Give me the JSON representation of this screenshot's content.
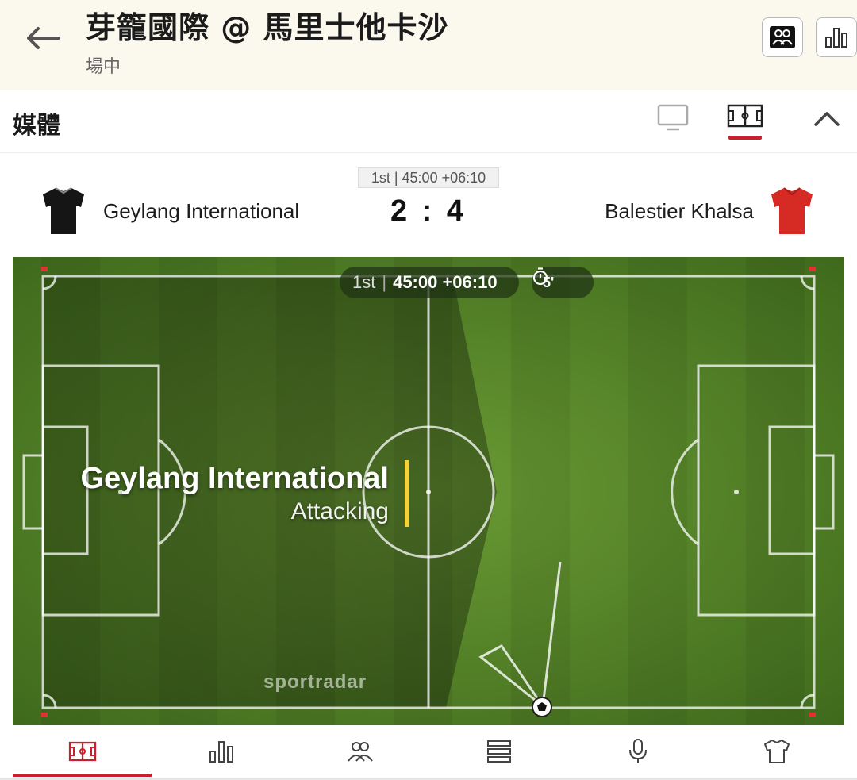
{
  "header": {
    "title": "芽籠國際 @ 馬里士他卡沙",
    "status": "場中",
    "icons": {
      "back": "arrow-left-icon",
      "lineups": "lineups-icon",
      "stats": "stats-bar-icon"
    }
  },
  "media": {
    "label": "媒體",
    "icons": {
      "tv": "tv-icon",
      "pitch": "pitch-tracker-icon",
      "collapse": "chevron-up-icon"
    },
    "accent": "#c8202d"
  },
  "match": {
    "period": "1st | 45:00 +06:10",
    "home": {
      "name": "Geylang International",
      "shirt_color": "#1a1a1a"
    },
    "away": {
      "name": "Balestier Khalsa",
      "shirt_color": "#d62a24"
    },
    "score": "2 : 4"
  },
  "tracker": {
    "period_label": "1st",
    "clock": "45:00 +06:10",
    "timer": "5'",
    "attacking_team": "Geylang International",
    "attacking_status": "Attacking",
    "brand": "sportradar",
    "indicator_color": "#f3d23a"
  },
  "tabs": [
    {
      "name": "pitch-tab",
      "icon": "pitch-icon",
      "active": true
    },
    {
      "name": "stats-tab",
      "icon": "stats-bar-icon",
      "active": false
    },
    {
      "name": "lineups-tab",
      "icon": "lineups-icon",
      "active": false
    },
    {
      "name": "timeline-tab",
      "icon": "list-icon",
      "active": false
    },
    {
      "name": "commentary-tab",
      "icon": "microphone-icon",
      "active": false
    },
    {
      "name": "kits-tab",
      "icon": "shirt-icon",
      "active": false
    }
  ]
}
